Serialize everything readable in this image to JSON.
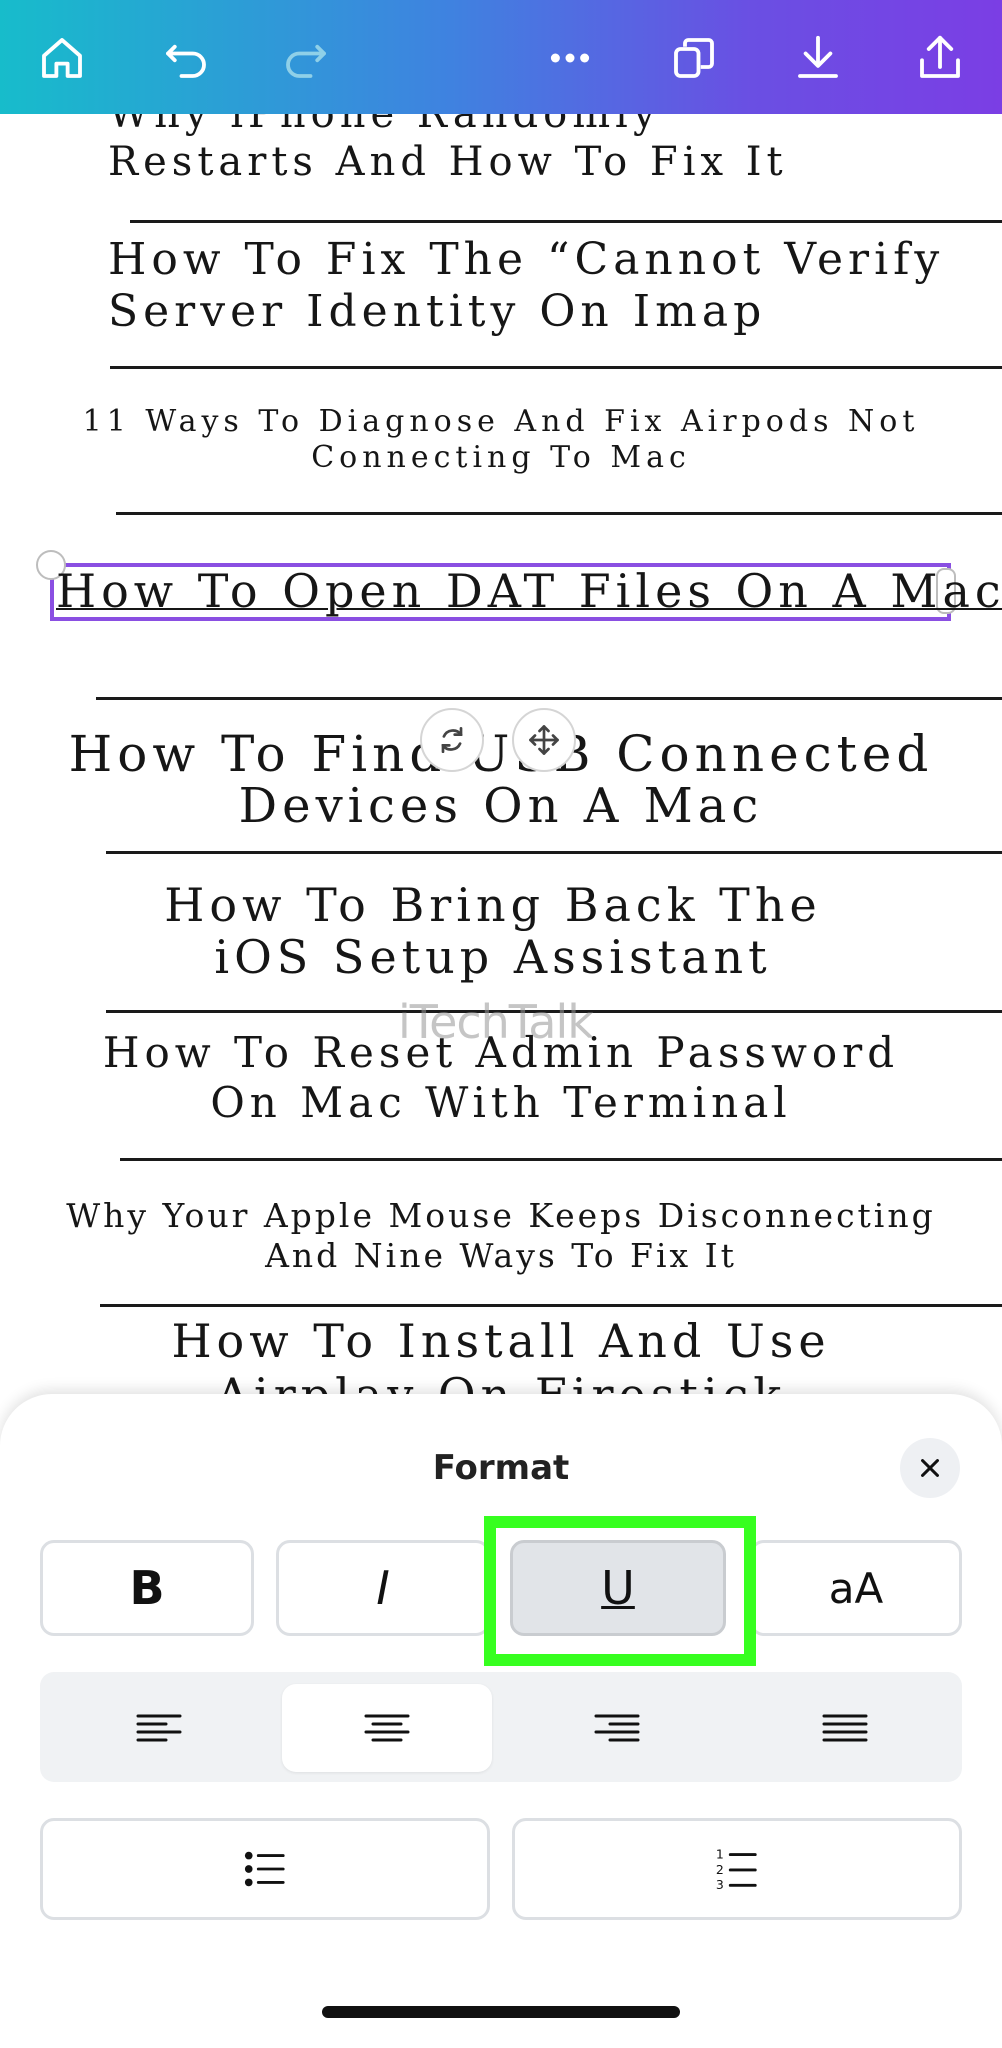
{
  "toolbar": {
    "buttons": [
      "home-icon",
      "undo-icon",
      "redo-icon",
      "more-icon",
      "duplicate-pages-icon",
      "download-icon",
      "share-icon"
    ],
    "gradient": [
      "#17bccb",
      "#7b3ee4"
    ]
  },
  "canvas": {
    "titles": [
      "Why iPhone Randomly",
      "Restarts And How To Fix It",
      "How To Fix The “Cannot Verify",
      "Server Identity On Imap",
      "11 Ways To Diagnose And Fix Airpods Not",
      "Connecting To Mac",
      "How To Open DAT Files On A Mac",
      "How To Find USB Connected",
      "Devices On A Mac",
      "How To Bring Back The",
      "iOS Setup Assistant",
      "How To Reset Admin Password",
      "On Mac With Terminal",
      "Why Your Apple Mouse Keeps Disconnecting",
      "And Nine Ways To Fix It",
      "How To Install And Use",
      "Airplay On Firestick"
    ],
    "watermark": "iTechTalk",
    "selection_color": "#8a4fe2"
  },
  "format_panel": {
    "title": "Format",
    "close_icon": "close-icon",
    "style_buttons": {
      "bold": "B",
      "italic": "I",
      "underline": "U",
      "case": "aA"
    },
    "active_style": "underline",
    "highlight_color": "#36ff1f",
    "alignment": [
      "align-left-icon",
      "align-center-icon",
      "align-right-icon",
      "align-justify-icon"
    ],
    "active_alignment": "align-center-icon",
    "list_buttons": [
      "bullet-list-icon",
      "numbered-list-icon"
    ]
  }
}
